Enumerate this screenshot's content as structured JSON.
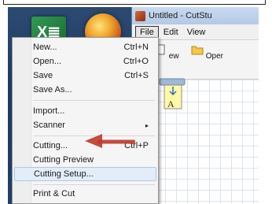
{
  "window": {
    "title": "Untitled - CutStu"
  },
  "menubar": [
    "File",
    "Edit",
    "View"
  ],
  "toolbar": [
    "ew",
    "Oper"
  ],
  "desktop_icons": {
    "excel": "X≣",
    "ie": "ie-icon"
  },
  "file_menu": {
    "items": [
      {
        "label": "New...",
        "shortcut": "Ctrl+N"
      },
      {
        "label": "Open...",
        "shortcut": "Ctrl+O"
      },
      {
        "label": "Save",
        "shortcut": "Ctrl+S"
      },
      {
        "label": "Save As...",
        "shortcut": ""
      },
      {
        "label": "Import...",
        "shortcut": ""
      },
      {
        "label": "Scanner",
        "shortcut": "▸"
      },
      {
        "label": "Cutting...",
        "shortcut": "Ctrl+P"
      },
      {
        "label": "Cutting Preview",
        "shortcut": ""
      },
      {
        "label": "Cutting Setup...",
        "shortcut": ""
      },
      {
        "label": "Print & Cut",
        "shortcut": ""
      }
    ]
  },
  "document_icon": {
    "letter": "A"
  },
  "colors": {
    "arrow": "#c0392b",
    "highlight": "#e3edf8"
  }
}
